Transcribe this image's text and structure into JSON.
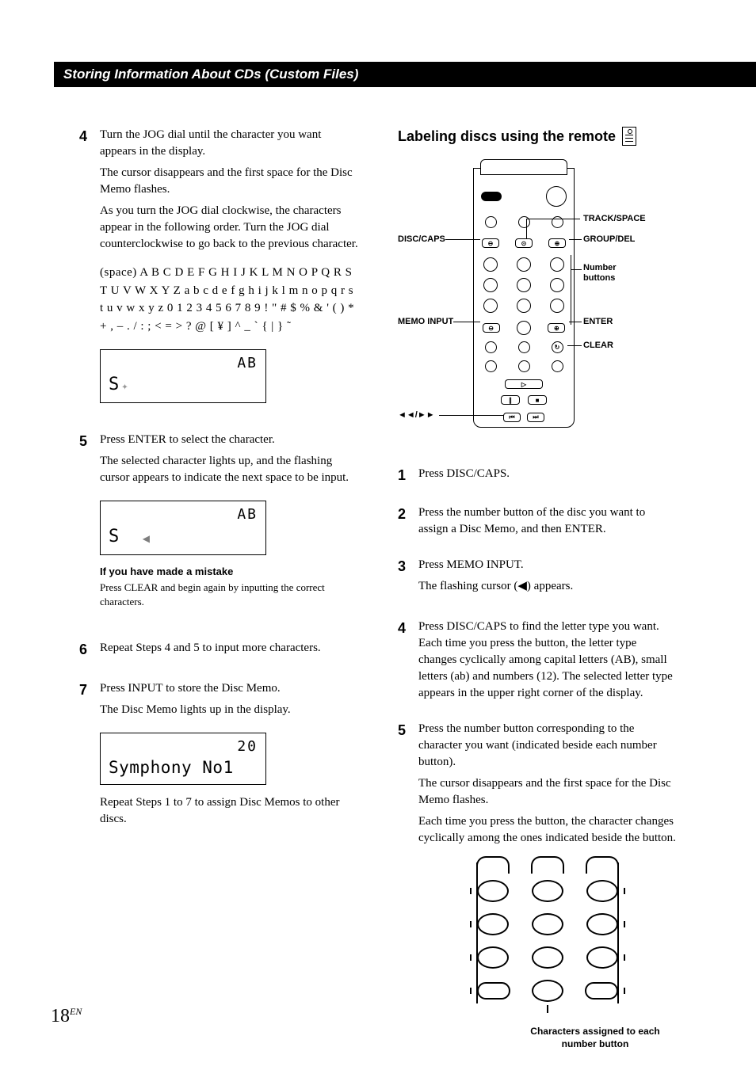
{
  "header": {
    "title": "Storing Information About CDs (Custom Files)"
  },
  "left": {
    "step4": {
      "num": "4",
      "p1": "Turn the JOG dial until the character you want appears in the display.",
      "p2": "The cursor disappears and the first space for the Disc Memo flashes.",
      "p3": "As you turn the JOG dial clockwise, the characters appear in the following order. Turn the JOG dial counterclockwise to go back to the previous character.",
      "chars": "(space) A B C D E F G H I J K L M N O P Q R S T U V W X Y Z a b c d e f g h i j k l m n o p q r s t u v w x y z 0 1 2 3 4 5 6 7 8 9 ! \" # $ % & ' ( ) * + , – . / : ; < = > ? @ [ ¥ ] ^ _ ` { | } ˜",
      "disp_top": "AB",
      "disp_bot": "S"
    },
    "step5": {
      "num": "5",
      "p1": "Press ENTER to select the character.",
      "p2": "The selected character lights up, and the flashing cursor appears to indicate the next space to be input.",
      "disp_top": "AB",
      "disp_bot": "S"
    },
    "mistake": {
      "title": "If you have made a mistake",
      "text": "Press CLEAR and begin again by inputting the correct characters."
    },
    "step6": {
      "num": "6",
      "p1": "Repeat Steps 4 and 5 to input more characters."
    },
    "step7": {
      "num": "7",
      "p1": "Press INPUT to store the Disc Memo.",
      "p2": "The Disc Memo lights up in the display.",
      "disp_top": "20",
      "disp_bot": "Symphony No1",
      "p3": "Repeat Steps 1 to 7 to assign Disc Memos to other discs."
    }
  },
  "right": {
    "heading": "Labeling discs using the remote",
    "labels": {
      "disc_caps": "DISC/CAPS",
      "memo_input": "MEMO INPUT",
      "prevnext": "./>",
      "track_space": "TRACK/SPACE",
      "group_del": "GROUP/DEL",
      "number_buttons": "Number buttons",
      "enter": "ENTER",
      "clear": "CLEAR"
    },
    "step1": {
      "num": "1",
      "p1": "Press DISC/CAPS."
    },
    "step2": {
      "num": "2",
      "p1": "Press the number button of the disc you want to assign a Disc Memo, and then ENTER."
    },
    "step3": {
      "num": "3",
      "p1": "Press MEMO INPUT.",
      "p2": "The flashing cursor (◀) appears."
    },
    "step4": {
      "num": "4",
      "p1": "Press DISC/CAPS to find the letter type you want. Each time you press the button, the letter type changes cyclically among capital letters (AB), small letters (ab) and numbers (12). The selected letter type appears in the upper right corner of the display."
    },
    "step5": {
      "num": "5",
      "p1": "Press the number button corresponding to the character you want (indicated beside each number button).",
      "p2": "The cursor disappears and the first space for the Disc Memo flashes.",
      "p3": "Each time you press the button, the character changes cyclically among the ones indicated beside the button."
    },
    "caption": "Characters assigned to each number button"
  },
  "page": {
    "num": "18",
    "suffix": "EN"
  }
}
